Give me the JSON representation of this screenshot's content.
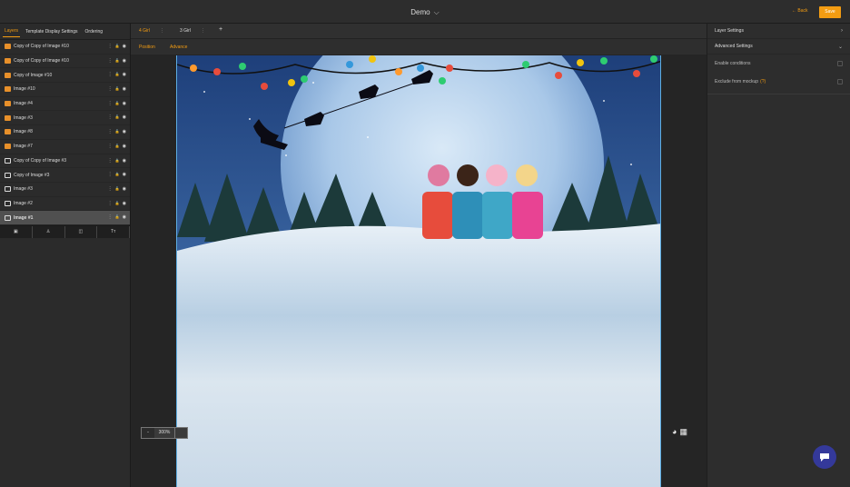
{
  "header": {
    "title": "Demo",
    "back_label": "← Back",
    "save_label": "Save"
  },
  "left": {
    "tabs": [
      {
        "label": "Layers",
        "active": true
      },
      {
        "label": "Template Display Settings",
        "active": false
      },
      {
        "label": "Ordering",
        "active": false
      }
    ],
    "layers": [
      {
        "name": "Copy of Copy of Image #10",
        "icon": "orange",
        "lock": "unlocked"
      },
      {
        "name": "Copy of Copy of Image #10",
        "icon": "orange",
        "lock": "unlocked"
      },
      {
        "name": "Copy of Image #10",
        "icon": "orange",
        "lock": "unlocked"
      },
      {
        "name": "Image #10",
        "icon": "orange",
        "lock": "unlocked"
      },
      {
        "name": "Image #4",
        "icon": "orange",
        "lock": "unlocked"
      },
      {
        "name": "Image #3",
        "icon": "orange",
        "lock": "unlocked"
      },
      {
        "name": "Image #8",
        "icon": "orange",
        "lock": "unlocked"
      },
      {
        "name": "Image #7",
        "icon": "orange",
        "lock": "unlocked"
      },
      {
        "name": "Copy of Copy of Image #3",
        "icon": "white",
        "lock": "locked"
      },
      {
        "name": "Copy of Image #3",
        "icon": "white",
        "lock": "locked"
      },
      {
        "name": "Image #3",
        "icon": "white",
        "lock": "unlocked"
      },
      {
        "name": "Image #2",
        "icon": "white",
        "lock": "unlocked"
      },
      {
        "name": "Image #1",
        "icon": "white",
        "lock": "unlocked",
        "selected": true
      }
    ],
    "tools": [
      "image-icon",
      "person-icon",
      "shape-icon",
      "text-icon"
    ]
  },
  "center": {
    "tabs": [
      {
        "label": "4 Girl",
        "active": true
      },
      {
        "label": "3 Girl",
        "active": false
      }
    ],
    "add_label": "+",
    "subtabs": [
      "Position",
      "Advance"
    ],
    "zoom": "300%"
  },
  "right": {
    "layer_settings": "Layer Settings",
    "advanced_settings": "Advanced Settings",
    "options": [
      {
        "label": "Enable conditions",
        "help": ""
      },
      {
        "label": "Exclude from mockup",
        "help": "(?)"
      }
    ]
  },
  "colors": {
    "accent": "#f39c12",
    "selection": "#5dade2",
    "chat": "#34399a"
  }
}
